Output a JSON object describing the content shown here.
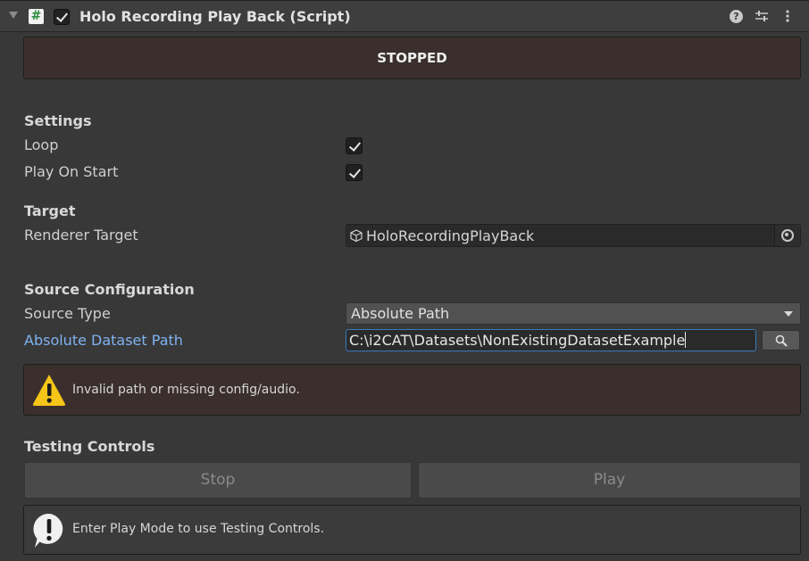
{
  "header": {
    "title": "Holo Recording Play Back (Script)",
    "script_icon_glyph": "#",
    "enabled": true,
    "help_glyph": "?"
  },
  "status": {
    "label": "STOPPED"
  },
  "settings": {
    "title": "Settings",
    "loop_label": "Loop",
    "loop_checked": true,
    "play_on_start_label": "Play On Start",
    "play_on_start_checked": true
  },
  "target": {
    "title": "Target",
    "renderer_target_label": "Renderer Target",
    "renderer_target_value": "HoloRecordingPlayBack"
  },
  "source": {
    "title": "Source Configuration",
    "source_type_label": "Source Type",
    "source_type_value": "Absolute Path",
    "dataset_path_label": "Absolute Dataset Path",
    "dataset_path_value": "C:\\i2CAT\\Datasets\\NonExistingDatasetExample",
    "warning": "Invalid path or missing config/audio."
  },
  "testing": {
    "title": "Testing Controls",
    "stop_label": "Stop",
    "play_label": "Play",
    "info": "Enter Play Mode to use Testing Controls."
  },
  "colors": {
    "background": "#383838",
    "header_background": "#3e3e3e",
    "status_background": "#3a2f2d",
    "focused_label": "#7fb2f0",
    "focus_border": "#3a79bb",
    "warning_yellow": "#f5c518"
  },
  "icons": {
    "foldout": "chevron-down-icon",
    "script": "script-icon",
    "help": "help-icon",
    "presets": "presets-icon",
    "menu": "kebab-menu-icon",
    "object": "cube-icon",
    "picker": "object-picker-icon",
    "browse": "magnifier-icon",
    "warning": "warning-icon",
    "info": "info-icon"
  }
}
